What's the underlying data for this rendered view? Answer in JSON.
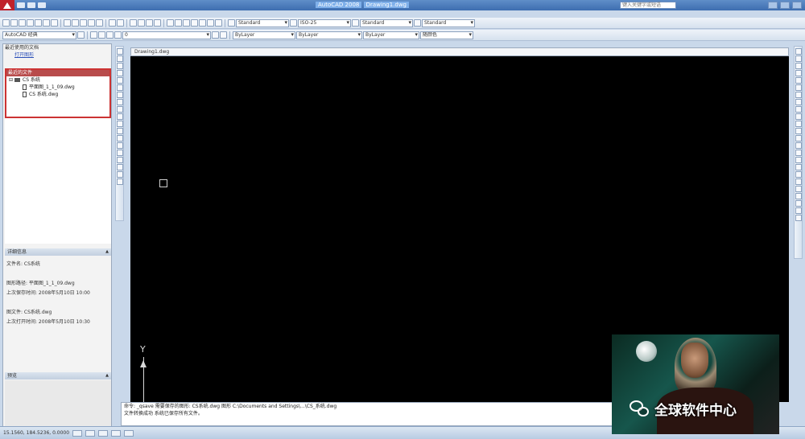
{
  "window": {
    "title": "AutoCAD 2008",
    "title_file": "Drawing1.dwg",
    "search_placeholder": "键入关键字或短语"
  },
  "toolbar1": {
    "text_style": "Standard",
    "dim_style": "ISO-25",
    "table_style": "Standard",
    "multileader_style": "Standard"
  },
  "toolbar2": {
    "workspace": "AutoCAD 经典",
    "layer": "0",
    "color": "ByLayer",
    "linetype": "ByLayer",
    "lineweight": "ByLayer",
    "plotstyle": "随颜色"
  },
  "left_palette": {
    "header": "最近使用的文档",
    "link": "打开图形",
    "recent_title": "最近的文件",
    "tree": [
      {
        "type": "folder",
        "label": "CS 系统"
      },
      {
        "type": "file",
        "label": "平面图_1_1_09.dwg"
      },
      {
        "type": "file",
        "label": "CS 系统.dwg"
      }
    ],
    "details_title": "详细信息",
    "details": [
      "文件名: CS系统",
      "图形路径: 平面图_1_1_09.dwg",
      "上次保存时间: 2008年5月10日 10:00",
      "图文件: CS系统.dwg",
      "上次打开时间: 2008年5月10日 10:30"
    ],
    "preview_title": "预览"
  },
  "drawing": {
    "tab": "Drawing1.dwg",
    "ucs_y": "Y"
  },
  "command": {
    "line1": "命令: _qsave 需要保存的图形: CS系统.dwg 图形 C:\\Documents and Settings\\...\\CS_系统.dwg",
    "line2": "文件转换成功 系统已保存所有文件。"
  },
  "statusbar": {
    "coords": "15.1560, 184.5236, 0.0000"
  },
  "overlay": {
    "text": "全球软件中心"
  }
}
